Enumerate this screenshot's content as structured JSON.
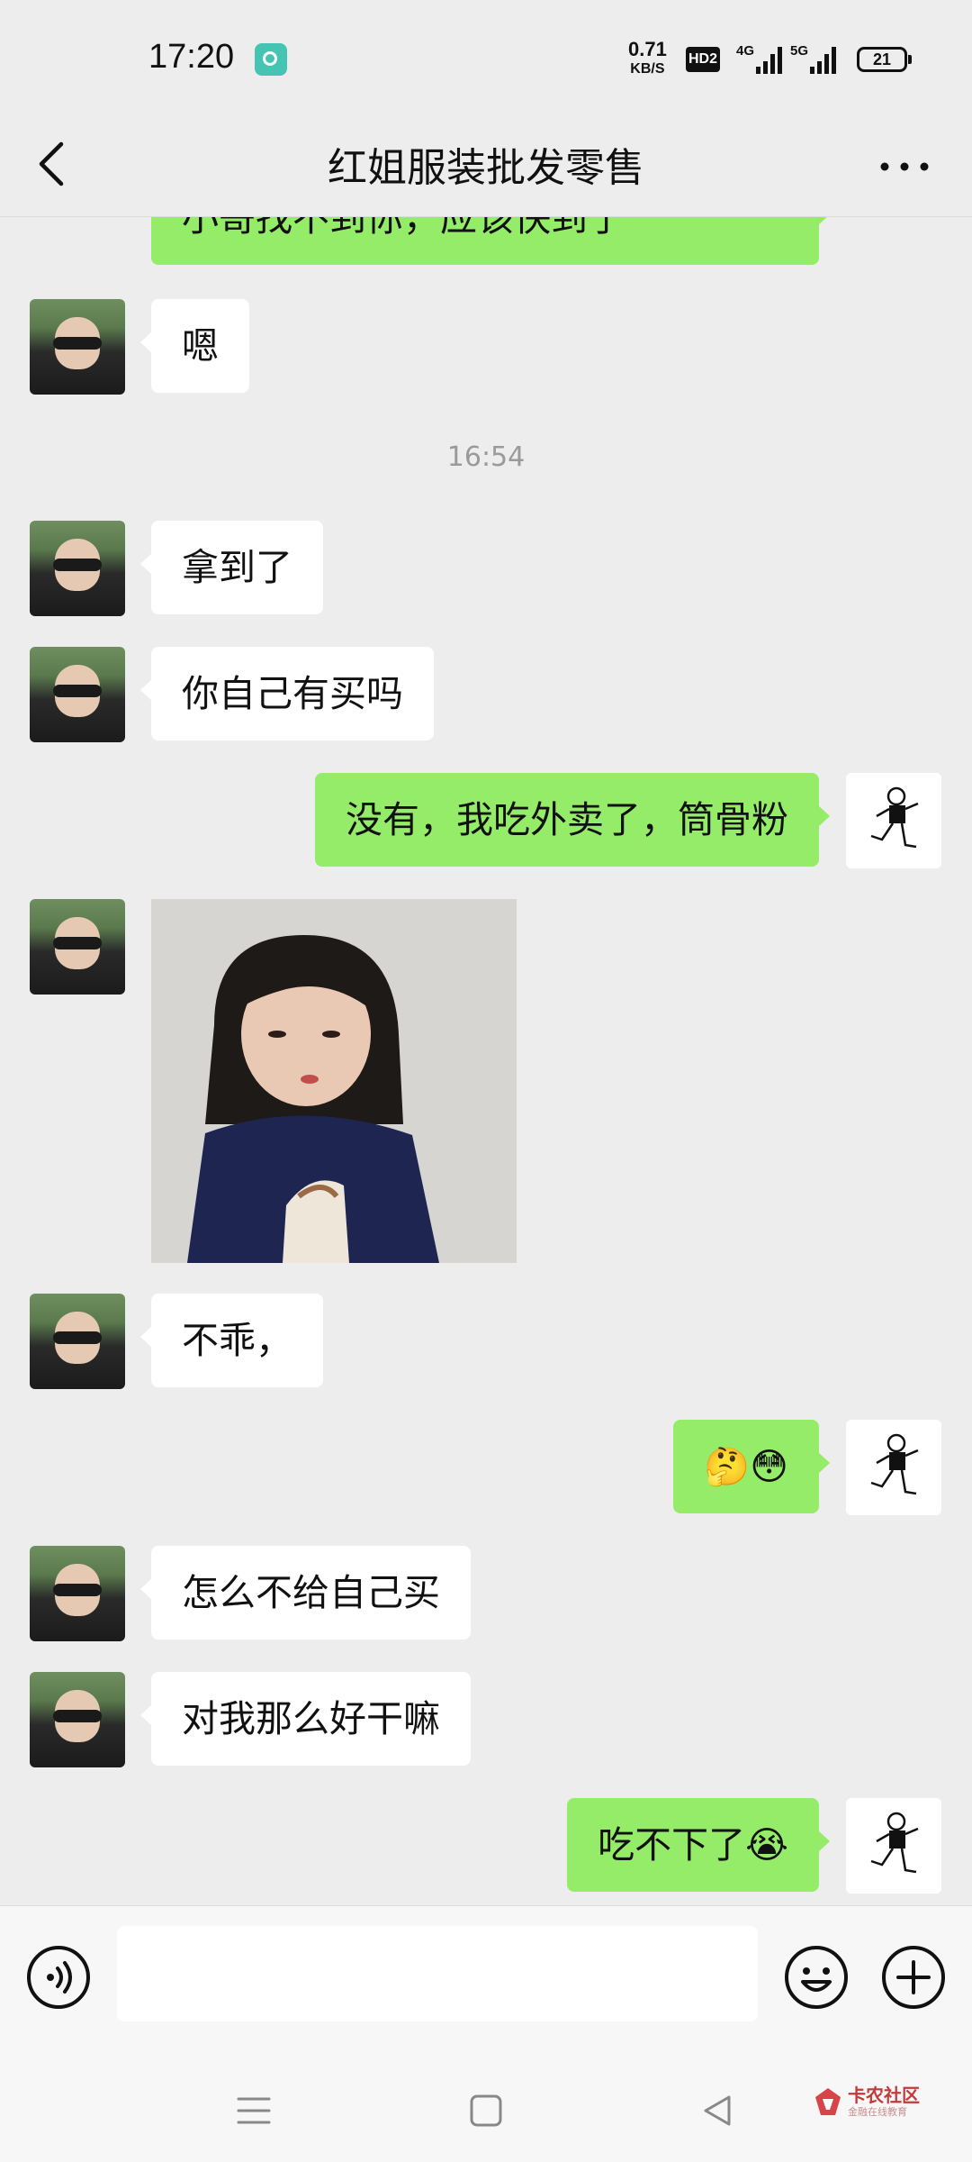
{
  "status_bar": {
    "time": "17:20",
    "net_speed": "0.71",
    "net_speed_unit": "KB/S",
    "hd_badge": "HD2",
    "signal_1": "4G",
    "signal_2": "5G",
    "battery": "21"
  },
  "header": {
    "title": "红姐服装批发零售"
  },
  "messages": [
    {
      "from": "me",
      "text": "小哥找不到你，应该快到了"
    },
    {
      "from": "her",
      "text": "嗯"
    },
    {
      "type": "timestamp",
      "text": "16:54"
    },
    {
      "from": "her",
      "text": "拿到了"
    },
    {
      "from": "her",
      "text": "你自己有买吗"
    },
    {
      "from": "me",
      "text": "没有，我吃外卖了，筒骨粉"
    },
    {
      "from": "her",
      "type": "image"
    },
    {
      "from": "her",
      "text": "不乖，"
    },
    {
      "from": "me",
      "text": "🤔😳"
    },
    {
      "from": "her",
      "text": "怎么不给自己买"
    },
    {
      "from": "her",
      "text": "对我那么好干嘛"
    },
    {
      "from": "me",
      "text": "吃不下了😭"
    }
  ],
  "input": {
    "value": "",
    "placeholder": ""
  },
  "watermark": {
    "title": "卡农社区",
    "subtitle": "金融在线教育"
  },
  "colors": {
    "background": "#ededed",
    "my_bubble": "#95ec69",
    "her_bubble": "#ffffff",
    "input_bar": "#f7f7f7"
  }
}
